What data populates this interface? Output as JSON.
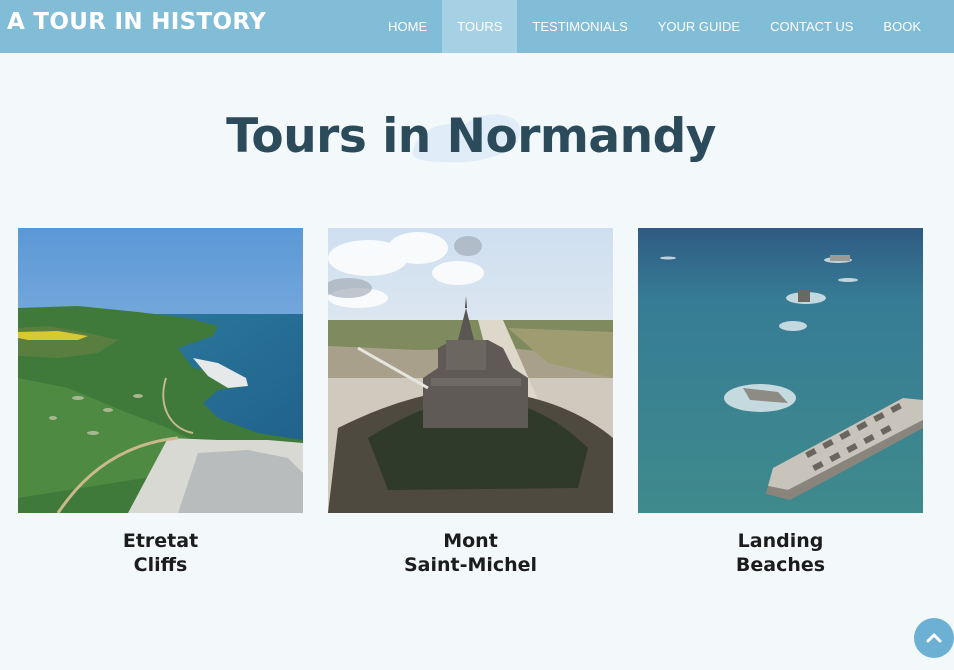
{
  "brand": "A TOUR IN HISTORY",
  "nav": {
    "items": [
      {
        "label": "HOME",
        "active": false
      },
      {
        "label": "TOURS",
        "active": true
      },
      {
        "label": "TESTIMONIALS",
        "active": false
      },
      {
        "label": "YOUR GUIDE",
        "active": false
      },
      {
        "label": "CONTACT US",
        "active": false
      },
      {
        "label": "BOOK",
        "active": false
      }
    ]
  },
  "page_title": "Tours in Normandy",
  "cards": [
    {
      "line1": "Etretat",
      "line2": "Cliffs",
      "image": "etretat-cliffs-aerial-photo"
    },
    {
      "line1": "Mont",
      "line2": "Saint-Michel",
      "image": "mont-saint-michel-aerial-photo"
    },
    {
      "line1": "Landing",
      "line2": "Beaches",
      "image": "landing-beaches-mulberry-harbour-photo"
    }
  ],
  "back_to_top": {
    "icon": "chevron-up-icon"
  },
  "colors": {
    "navbar": "#82bdd8",
    "nav_active": "#a6d0e3",
    "page_bg": "#f3f8fb",
    "title": "#2b4a5a",
    "back_to_top": "#6cb0d3"
  }
}
